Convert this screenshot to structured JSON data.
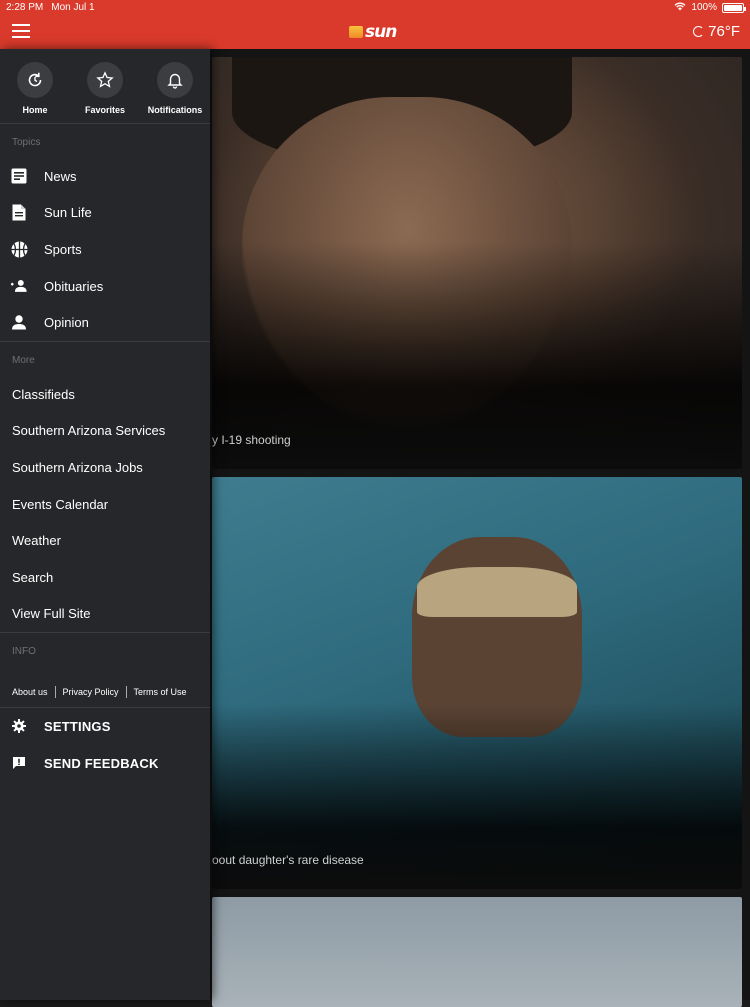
{
  "status_bar": {
    "time": "2:28 PM",
    "date": "Mon Jul 1",
    "battery": "100%"
  },
  "header": {
    "logo_text": "sun",
    "temperature": "76°F"
  },
  "drawer": {
    "quick_actions": [
      {
        "label": "Home",
        "icon": "refresh-icon"
      },
      {
        "label": "Favorites",
        "icon": "star-icon"
      },
      {
        "label": "Notifications",
        "icon": "bell-icon"
      }
    ],
    "topics_label": "Topics",
    "topics": [
      {
        "label": "News",
        "icon": "news-icon"
      },
      {
        "label": "Sun Life",
        "icon": "document-icon"
      },
      {
        "label": "Sports",
        "icon": "basketball-icon"
      },
      {
        "label": "Obituaries",
        "icon": "people-icon"
      },
      {
        "label": "Opinion",
        "icon": "person-icon"
      }
    ],
    "more_label": "More",
    "more": [
      "Classifieds",
      "Southern Arizona Services",
      "Southern Arizona Jobs",
      "Events Calendar",
      "Weather",
      "Search",
      "View Full Site"
    ],
    "info_label": "INFO",
    "info_links": [
      "About us",
      "Privacy Policy",
      "Terms of Use"
    ],
    "settings_label": "SETTINGS",
    "feedback_label": "SEND FEEDBACK"
  },
  "feed": {
    "cards": [
      {
        "title_fragment": "y I-19 shooting"
      },
      {
        "title_fragment": "oout daughter's rare disease"
      }
    ]
  },
  "colors": {
    "brand_red": "#d93a2b",
    "drawer_bg": "#26272a"
  }
}
